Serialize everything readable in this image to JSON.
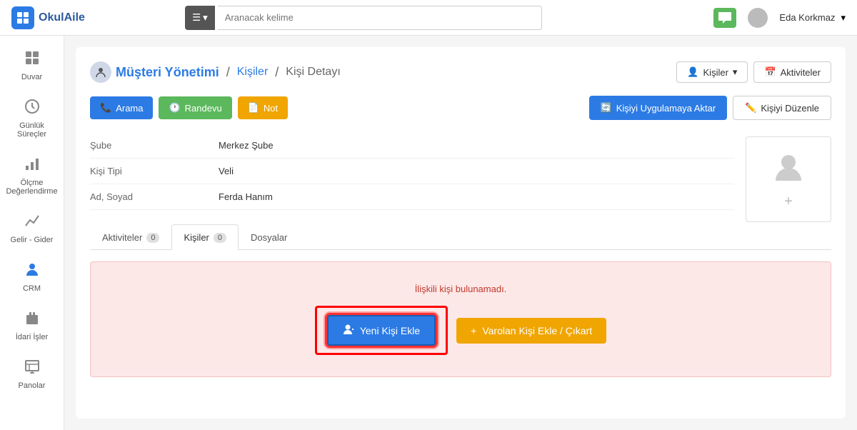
{
  "topbar": {
    "logo_text": "OkulAile",
    "search_placeholder": "Aranacak kelime",
    "user_name": "Eda Korkmaz",
    "menu_icon": "☰"
  },
  "sidebar": {
    "items": [
      {
        "id": "duvar",
        "label": "Duvar",
        "icon": "⊞"
      },
      {
        "id": "gunluk",
        "label": "Günlük Süreçler",
        "icon": "⏱"
      },
      {
        "id": "olcme",
        "label": "Ölçme Değerlendirme",
        "icon": "📊"
      },
      {
        "id": "gelir",
        "label": "Gelir - Gider",
        "icon": "📈"
      },
      {
        "id": "crm",
        "label": "CRM",
        "icon": "👤"
      },
      {
        "id": "idari",
        "label": "İdari İşler",
        "icon": "💼"
      },
      {
        "id": "panolar",
        "label": "Panolar",
        "icon": "📋"
      }
    ]
  },
  "breadcrumb": {
    "module": "Müşteri Yönetimi",
    "section": "Kişiler",
    "page": "Kişi Detayı",
    "sep1": "/",
    "sep2": "/"
  },
  "breadcrumb_buttons": {
    "kisiler": "Kişiler",
    "aktiviteler": "Aktiviteler",
    "kisiler_icon": "👤",
    "aktiviteler_icon": "📅"
  },
  "actions": {
    "arama": "Arama",
    "randevu": "Randevu",
    "not": "Not",
    "aktar": "Kişiyi Uygulamaya Aktar",
    "duzenle": "Kişiyi Düzenle",
    "arama_icon": "📞",
    "randevu_icon": "🕐",
    "not_icon": "📄",
    "aktar_icon": "🔄",
    "duzenle_icon": "✏️"
  },
  "person": {
    "sube_label": "Şube",
    "sube_value": "Merkez Şube",
    "kisi_tipi_label": "Kişi Tipi",
    "kisi_tipi_value": "Veli",
    "ad_soyad_label": "Ad, Soyad",
    "ad_soyad_value": "Ferda Hanım"
  },
  "tabs": [
    {
      "id": "aktiviteler",
      "label": "Aktiviteler",
      "count": "0"
    },
    {
      "id": "kisiler",
      "label": "Kişiler",
      "count": "0",
      "active": true
    },
    {
      "id": "dosyalar",
      "label": "Dosyalar",
      "count": null
    }
  ],
  "kisiler_panel": {
    "empty_text": "İlişkili kişi bulunamadı.",
    "new_btn": "Yeni Kişi Ekle",
    "varolan_btn": "Varolan Kişi Ekle / Çıkart",
    "new_icon": "👤",
    "varolan_icon": "+"
  }
}
